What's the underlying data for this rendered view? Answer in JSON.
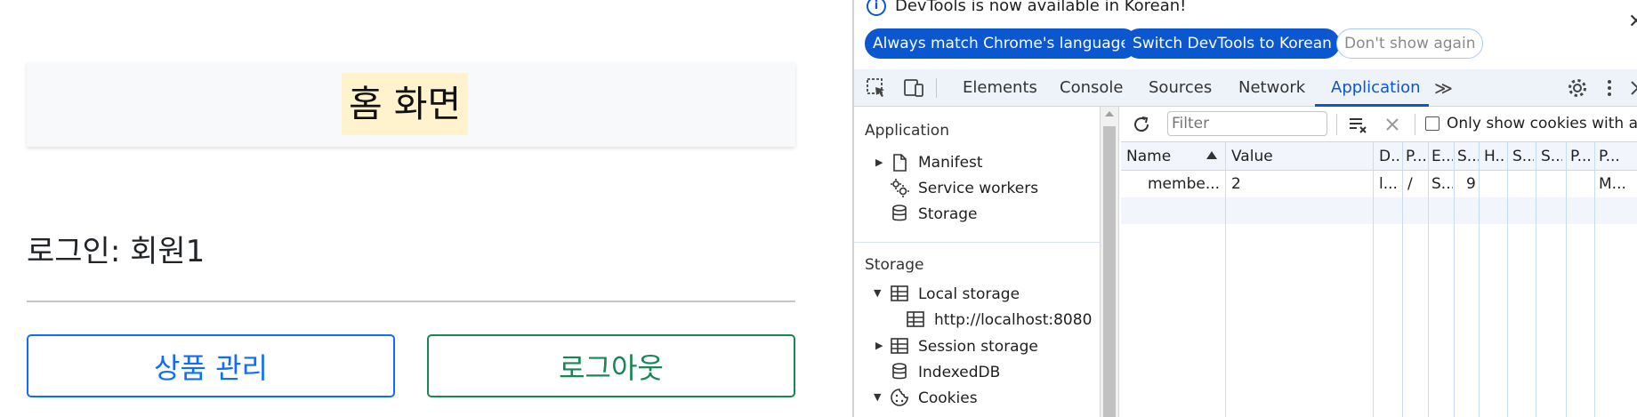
{
  "page": {
    "title": "홈 화면",
    "login_status": "로그인: 회원1",
    "product_button": "상품 관리",
    "logout_button": "로그아웃"
  },
  "devtools": {
    "infobar": {
      "message": "DevTools is now available in Korean!",
      "always_match": "Always match Chrome's language",
      "switch": "Switch DevTools to Korean",
      "dont_show": "Don't show again",
      "close": "✕"
    },
    "tabs": [
      {
        "label": "Elements"
      },
      {
        "label": "Console"
      },
      {
        "label": "Sources"
      },
      {
        "label": "Network"
      },
      {
        "label": "Application"
      }
    ],
    "more_tabs": "≫",
    "sidebar": {
      "application_heading": "Application",
      "manifest": "Manifest",
      "service_workers": "Service workers",
      "storage_item": "Storage",
      "storage_heading": "Storage",
      "local_storage": "Local storage",
      "localhost": "http://localhost:8080",
      "session_storage": "Session storage",
      "indexeddb": "IndexedDB",
      "cookies": "Cookies"
    },
    "cookies_toolbar": {
      "filter_placeholder": "Filter",
      "only_show_label": "Only show cookies with a..."
    },
    "cookie_table": {
      "columns": [
        "Name",
        "Value",
        "D...",
        "P...",
        "E...",
        "S...",
        "H...",
        "S...",
        "S...",
        "P...",
        "P..."
      ],
      "rows": [
        {
          "name": "membe...",
          "value": "2",
          "domain": "l...",
          "path": "/",
          "expires": "S...",
          "size": "9",
          "priority": "M..."
        }
      ]
    },
    "colors": {
      "accent": "#0b57d0",
      "primary_button": "#0d6efd",
      "success_button": "#198754",
      "title_highlight": "#fff3cd"
    }
  }
}
